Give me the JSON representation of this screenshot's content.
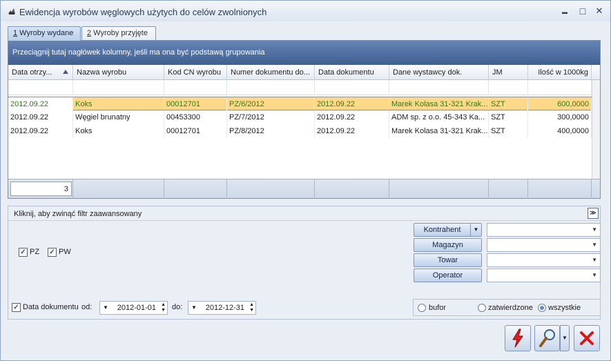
{
  "window": {
    "title": "Ewidencja wyrobów węglowych użytych do celów zwolnionych",
    "minimize": "▬",
    "maximize": "□",
    "close": "✕"
  },
  "tabs": [
    {
      "label": "1 Wyroby wydane",
      "key": "1",
      "rest": " Wyroby wydane"
    },
    {
      "label": "2 Wyroby przyjęte",
      "key": "2",
      "rest": " Wyroby przyjęte"
    }
  ],
  "grid": {
    "group_hint": "Przeciągnij tutaj nagłówek kolumny, jeśli ma ona być podstawą grupowania",
    "columns": [
      "Data otrzy...",
      "Nazwa wyrobu",
      "Kod CN wyrobu",
      "Numer dokumentu do...",
      "Data dokumentu",
      "Dane wystawcy dok.",
      "JM",
      "Ilość w 1000kg"
    ],
    "rows": [
      [
        "2012.09.22",
        "Koks",
        "00012701",
        "PZ/6/2012",
        "2012.09.22",
        "Marek Kolasa 31-321 Krak...",
        "SZT",
        "600,0000"
      ],
      [
        "2012.09.22",
        "Węgiel brunatny",
        "00453300",
        "PZ/7/2012",
        "2012.09.22",
        "ADM sp. z o.o. 45-343 Ka...",
        "SZT",
        "300,0000"
      ],
      [
        "2012.09.22",
        "Koks",
        "00012701",
        "PZ/8/2012",
        "2012.09.22",
        "Marek Kolasa 31-321 Krak...",
        "SZT",
        "400,0000"
      ]
    ],
    "row_count": "3"
  },
  "filter": {
    "toggle_label": "Kliknij, aby zwinąć filtr zaawansowany",
    "pz_label": "PZ",
    "pw_label": "PW",
    "kontrahent_label": "Kontrahent",
    "magazyn_label": "Magazyn",
    "towar_label": "Towar",
    "operator_label": "Operator",
    "data_dokumentu_label": "Data dokumentu",
    "od_label": "od:",
    "do_label": "do:",
    "date_from": "2012-01-01",
    "date_to": "2012-12-31",
    "radio_bufor": "bufor",
    "radio_zatwierdzone": "zatwierdzone",
    "radio_wszystkie": "wszystkie"
  },
  "colors": {
    "selected_row": "#ffd98a",
    "selected_text": "#2a7a1a",
    "group_panel": "#4a6a9e"
  }
}
